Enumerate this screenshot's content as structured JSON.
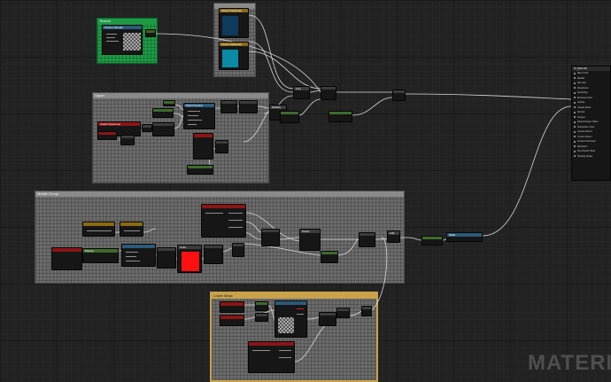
{
  "canvas": {
    "background": "#222222",
    "watermark": "MATERIA"
  },
  "comments": [
    {
      "name": "comment-texture",
      "title": "Texture",
      "color": "#1e9a45"
    },
    {
      "name": "comment-colors",
      "title": "",
      "color": "#8a8a8a"
    },
    {
      "name": "comment-upper",
      "title": "Upper",
      "color": "#8a8a8a"
    },
    {
      "name": "comment-middle",
      "title": "Middle Group",
      "color": "#8a8a8a"
    },
    {
      "name": "comment-lower",
      "title": "Lower Mask",
      "color": "#c9a24a"
    }
  ],
  "nodes": {
    "texture_sample": "Texture Sample",
    "vector_param_1": "Vector Parameter",
    "vector_param_2": "Vector Parameter",
    "scalar_param": "Scalar Parameter",
    "lerp": "Lerp",
    "multiply": "Multiply",
    "add": "Add",
    "constant": "Constant",
    "texcoord": "TexCoord",
    "panner": "Panner",
    "mask": "Mask",
    "red_swatch": "Color",
    "one_minus": "1-x",
    "saturate": "Saturate",
    "append": "Append",
    "power": "Power",
    "world_position": "World Position",
    "output_const": "0.5",
    "const_values": "1.000 1.000 1.000"
  },
  "output_panel": {
    "title": "M_Material",
    "rows": [
      "Base Color",
      "Metallic",
      "Specular",
      "Roughness",
      "Anisotropy",
      "Emissive Color",
      "Opacity",
      "Opacity Mask",
      "Normal",
      "Tangent",
      "World Position Offset",
      "Subsurface Color",
      "Custom Data 0",
      "Custom Data 1",
      "Ambient Occlusion",
      "Refraction",
      "Pixel Depth Offset",
      "Shading Model"
    ]
  },
  "colors": {
    "green_comment": "#1e9a45",
    "gold_comment": "#c9a24a",
    "red_swatch": "#ff1010",
    "blue_dark": "#0e3a5c",
    "blue_teal": "#0b8aa6",
    "header_red": "#8b1515",
    "header_olive": "#4e5a24",
    "header_green": "#3d6b2c",
    "header_blue": "#2b5a7a",
    "header_gold": "#8a6a14",
    "header_gray": "#3c3c3c"
  }
}
